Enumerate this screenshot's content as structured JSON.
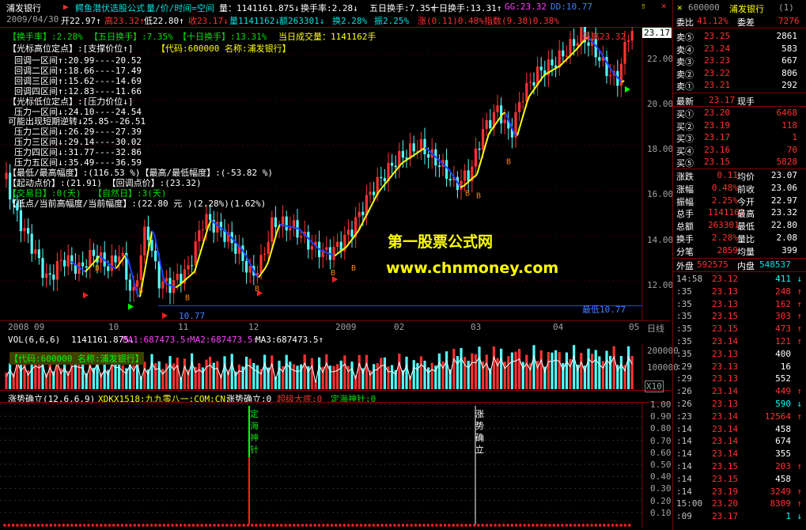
{
  "title_bar": {
    "stock_name": "浦发银行",
    "formula_name": "鳄鱼潜伏选股公式",
    "mode_text": "量/价/时间=空间",
    "vol_text": "量：1141161.875↓",
    "turnover_text": "换手率:2.28↓",
    "turnover5_text": "五日换手:7.35↑",
    "turnover10_text": "十日换手:13.31↑",
    "gg_text": "GG:23.32",
    "dd_text": "DD:10.77"
  },
  "quote_line": {
    "date": "2009/04/30",
    "open": "开22.97↑",
    "high": "高23.32↑",
    "low": "低22.80↑",
    "close": "收23.17↓",
    "volume": "量1141162↓",
    "amount": "额263301↓",
    "turnover": "换2.28%",
    "amplitude": "振2.25%",
    "change": "涨(0.11)0.48%",
    "index": "指数(9.38)0.38%"
  },
  "info_panel": {
    "row1": {
      "t1": "【换手率】:2.28%",
      "t2": "【五日换手】:7.35%",
      "t3": "【十日换手】:13.31%",
      "t4": "当日成交量：1141162手"
    },
    "row2": {
      "t1": "【光标高位定点】:[支撑价位↑]",
      "t2": "【代码:600000 名称:浦发银行】"
    },
    "support": [
      "回调一区间↑:20.99----20.52",
      "回调二区间↑:18.66----17.49",
      "回调三区间↑:15.62----14.69",
      "回调四区间↑:12.83----11.66"
    ],
    "row_low": "【光标低位定点】:[压力价位↓]",
    "pressure1": "压力一区间↓:24.10----24.54",
    "reverse": "可能出现短期逆转↓25.85--26.51",
    "pressure": [
      "压力二区间↓:26.29----27.39",
      "压力三区间↓:29.14----30.02",
      "压力四区间↓:31.77----32.86",
      "压力五区间↓:35.49----36.59"
    ],
    "amp_line": "【最低/最高幅度】:(116.53 %)【最高/最低幅度】:(-53.82 %)",
    "start_line": "【起动点价】:(21.91)      【回调点价】:(23.32)",
    "trade_day": "【交易日】:0(天)",
    "natural_day": "【自然日】:3(天)",
    "low_line": "【低点/当前高幅度/当前幅度】:(22.80 元 )(2.28%)(1.62%)"
  },
  "price_axis": {
    "labels": [
      "22.00",
      "20.00",
      "18.00",
      "16.00",
      "14.00",
      "12.00"
    ],
    "current": "23.17"
  },
  "annotations": {
    "highest": "最高23.32",
    "lowest_left": "10.77",
    "lowest_right": "最低10.77",
    "b_mark": "B"
  },
  "time_axis": {
    "labels": [
      "2008",
      "09",
      "10",
      "11",
      "12",
      "2009",
      "02",
      "03",
      "04",
      "05"
    ],
    "period": "日线"
  },
  "watermark": {
    "line1": "第一股票公式网",
    "line2": "www.chnmoney.com"
  },
  "volume": {
    "header_vol": "VOL(6,6,6)",
    "vol_value": "1141161.875↓",
    "ma1": "MA1:687473.5↑",
    "ma2": "MA2:687473.5↑",
    "ma3": "MA3:687473.5↑",
    "code_tag": "【代码:600000 名称:浦发银行】",
    "axis_top": "200000",
    "axis_mid": "100000",
    "unit": "X10"
  },
  "indicator": {
    "name": "涨势确立(12,6,6,9)",
    "xdkx": "XDKX1518:九九零八一:COM:CN:",
    "trend": "涨势确立:0",
    "super": "超级大底:0",
    "needle": "定海神针:0",
    "axis": [
      "1.00",
      "0.90",
      "0.80",
      "0.70",
      "0.60",
      "0.50",
      "0.40",
      "0.30",
      "0.20",
      "0.10"
    ],
    "label_needle": [
      "定",
      "海",
      "神",
      "针"
    ],
    "label_trend": [
      "涨",
      "势",
      "确",
      "立"
    ]
  },
  "quote_panel": {
    "code": "600000",
    "name": "浦发银行",
    "webi_label": "委比",
    "webi_value": "41.12%",
    "weicha_label": "委差",
    "weicha_value": "7276",
    "sell": [
      {
        "label": "卖⑤",
        "price": "23.25",
        "vol": "2861"
      },
      {
        "label": "卖④",
        "price": "23.24",
        "vol": "583"
      },
      {
        "label": "卖③",
        "price": "23.23",
        "vol": "667"
      },
      {
        "label": "卖②",
        "price": "23.22",
        "vol": "806"
      },
      {
        "label": "卖①",
        "price": "23.21",
        "vol": "292"
      }
    ],
    "latest_label": "最新",
    "latest": "23.17",
    "now_label": "现手",
    "buy": [
      {
        "label": "买①",
        "price": "23.20",
        "vol": "6468"
      },
      {
        "label": "买②",
        "price": "23.19",
        "vol": "118"
      },
      {
        "label": "买③",
        "price": "23.17",
        "vol": "1"
      },
      {
        "label": "买④",
        "price": "23.16",
        "vol": "70"
      },
      {
        "label": "买⑤",
        "price": "23.15",
        "vol": "5828"
      }
    ],
    "stats": [
      {
        "l1": "涨跌",
        "v1": "0.11",
        "l2": "均价",
        "v2": "23.07"
      },
      {
        "l1": "涨幅",
        "v1": "0.48%",
        "l2": "前收",
        "v2": "23.06"
      },
      {
        "l1": "振幅",
        "v1": "2.25%",
        "l2": "今开",
        "v2": "22.97"
      },
      {
        "l1": "总手",
        "v1": "1141162",
        "l2": "最高",
        "v2": "23.32"
      },
      {
        "l1": "总额",
        "v1": "263301",
        "l2": "最低",
        "v2": "22.80"
      },
      {
        "l1": "换手",
        "v1": "2.28%",
        "l2": "量比",
        "v2": "2.08"
      },
      {
        "l1": "分笔",
        "v1": "2859",
        "l2": "均量",
        "v2": "399"
      }
    ],
    "outer_label": "外盘",
    "outer": "592575",
    "inner_label": "内盘",
    "inner": "548537",
    "ticks": [
      {
        "t": "14:58",
        "p": "23.12",
        "v": "411",
        "d": "↓"
      },
      {
        "t": ":35",
        "p": "23.13",
        "v": "248",
        "d": "↑"
      },
      {
        "t": ":35",
        "p": "23.13",
        "v": "162",
        "d": "↑"
      },
      {
        "t": ":35",
        "p": "23.15",
        "v": "303",
        "d": "↑"
      },
      {
        "t": ":35",
        "p": "23.15",
        "v": "473",
        "d": "↑"
      },
      {
        "t": ":35",
        "p": "23.14",
        "v": "121",
        "d": "↑"
      },
      {
        "t": ":35",
        "p": "23.13",
        "v": "400",
        "d": ""
      },
      {
        "t": ":29",
        "p": "23.13",
        "v": "16",
        "d": ""
      },
      {
        "t": ":29",
        "p": "23.13",
        "v": "552",
        "d": ""
      },
      {
        "t": ":26",
        "p": "23.14",
        "v": "449",
        "d": "↑"
      },
      {
        "t": ":26",
        "p": "23.13",
        "v": "590",
        "d": "↓"
      },
      {
        "t": ":23",
        "p": "23.14",
        "v": "12564",
        "d": "↑"
      },
      {
        "t": ":14",
        "p": "23.14",
        "v": "458",
        "d": ""
      },
      {
        "t": ":14",
        "p": "23.14",
        "v": "674",
        "d": ""
      },
      {
        "t": ":14",
        "p": "23.14",
        "v": "355",
        "d": ""
      },
      {
        "t": ":14",
        "p": "23.15",
        "v": "203",
        "d": "↑"
      },
      {
        "t": ":14",
        "p": "23.15",
        "v": "458",
        "d": ""
      },
      {
        "t": ":14",
        "p": "23.19",
        "v": "3249",
        "d": "↑"
      },
      {
        "t": "15:00",
        "p": "23.20",
        "v": "8309",
        "d": "↑"
      },
      {
        "t": ":09",
        "p": "23.17",
        "v": "1",
        "d": "↓"
      }
    ]
  },
  "colors": {
    "up": "#ff3232",
    "down": "#54ffff",
    "ma_up": "#ffff00",
    "ma_down": "#2040ff",
    "grid": "#800000"
  }
}
